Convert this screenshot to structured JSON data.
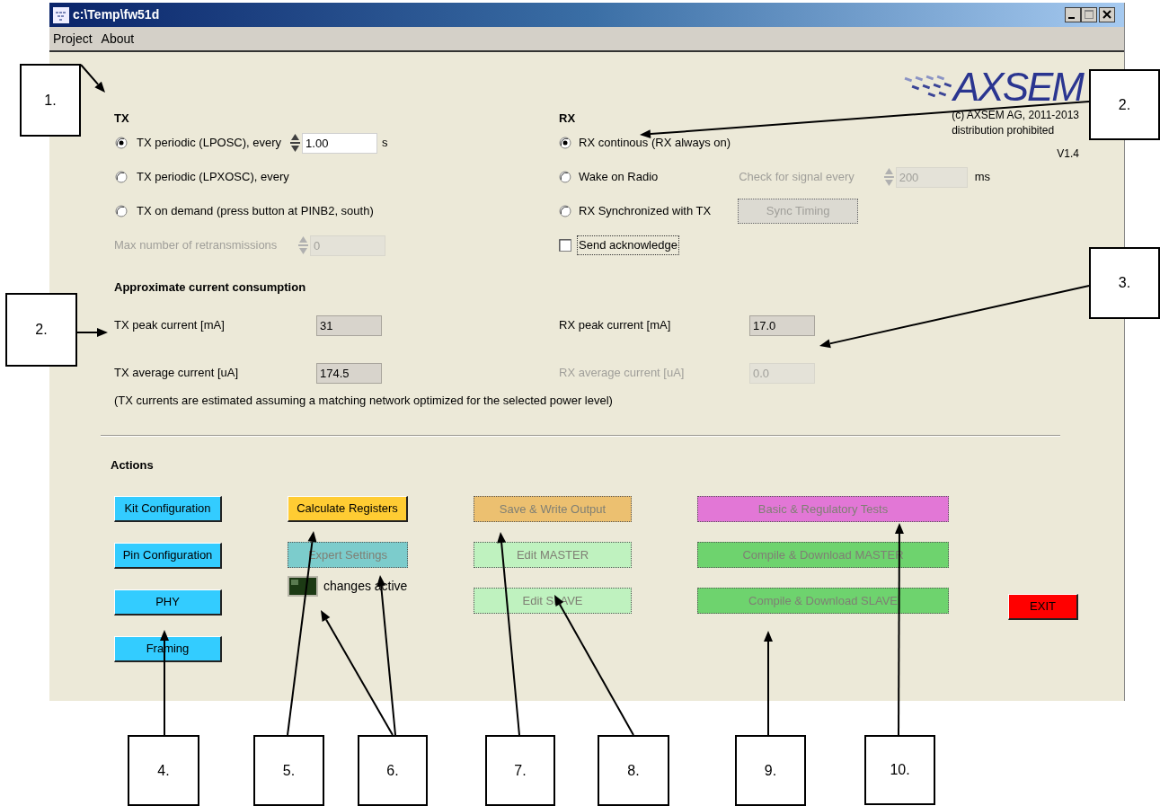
{
  "window": {
    "title": "c:\\Temp\\fw51d"
  },
  "menu": [
    "Project",
    "About"
  ],
  "brand": {
    "wordmark": "AXSEM",
    "copyright": "(c) AXSEM AG, 2011-2013",
    "notice": "distribution prohibited",
    "version": "V1.4"
  },
  "tx": {
    "heading": "TX",
    "options": [
      {
        "label": "TX periodic (LPOSC), every",
        "selected": true
      },
      {
        "label": "TX periodic (LPXOSC), every",
        "selected": false
      },
      {
        "label": "TX on demand (press button at PINB2, south)",
        "selected": false
      }
    ],
    "interval": {
      "value": "1.00",
      "unit": "s"
    },
    "retransmissions": {
      "label": "Max number of retransmissions",
      "value": "0",
      "disabled": true
    }
  },
  "rx": {
    "heading": "RX",
    "options": [
      {
        "label": "RX continous (RX always on)",
        "selected": true
      },
      {
        "label": "Wake on Radio",
        "selected": false
      },
      {
        "label": "RX Synchronized with TX",
        "selected": false
      }
    ],
    "check_interval": {
      "label": "Check for signal every",
      "value": "200",
      "unit": "ms",
      "disabled": true
    },
    "sync_button": {
      "label": "Sync Timing",
      "disabled": true
    },
    "acknowledge": {
      "label": "Send acknowledge",
      "checked": false
    }
  },
  "current": {
    "heading": "Approximate current consumption",
    "fields": [
      {
        "label": "TX peak current [mA]",
        "value": "31",
        "disabled": false
      },
      {
        "label": "RX peak current [mA]",
        "value": "17.0",
        "disabled": false
      },
      {
        "label": "TX average current [uA]",
        "value": "174.5",
        "disabled": false
      },
      {
        "label": "RX average current [uA]",
        "value": "0.0",
        "disabled": true
      }
    ],
    "note": "(TX currents are estimated assuming a matching network optimized for the selected power level)"
  },
  "actions": {
    "heading": "Actions",
    "columns": [
      {
        "items": [
          {
            "kind": "button",
            "label": "Kit Configuration",
            "color": "#33ccff",
            "disabled": false
          },
          {
            "kind": "button",
            "label": "Pin Configuration",
            "color": "#33ccff",
            "disabled": false
          },
          {
            "kind": "button",
            "label": "PHY",
            "color": "#33ccff",
            "disabled": false
          },
          {
            "kind": "button",
            "label": "Framing",
            "color": "#33ccff",
            "disabled": false
          }
        ]
      },
      {
        "items": [
          {
            "kind": "button",
            "label": "Calculate Registers",
            "color": "#ffcc33",
            "disabled": false
          },
          {
            "kind": "button",
            "label": "Expert Settings",
            "color": "#7ccccc",
            "disabled": true
          },
          {
            "kind": "indicator",
            "label": "changes active",
            "on": false
          }
        ]
      },
      {
        "items": [
          {
            "kind": "button",
            "label": "Save & Write Output",
            "color": "#ecc070",
            "disabled": true
          },
          {
            "kind": "button",
            "label": "Edit MASTER",
            "color": "#bff2bf",
            "disabled": true
          },
          {
            "kind": "button",
            "label": "Edit SLAVE",
            "color": "#bff2bf",
            "disabled": true
          }
        ]
      },
      {
        "items": [
          {
            "kind": "button",
            "label": "Basic & Regulatory Tests",
            "color": "#e277d6",
            "disabled": true
          },
          {
            "kind": "button",
            "label": "Compile & Download MASTER",
            "color": "#6ed36e",
            "disabled": true
          },
          {
            "kind": "button",
            "label": "Compile & Download SLAVE",
            "color": "#6ed36e",
            "disabled": true
          }
        ]
      }
    ],
    "exit_button": {
      "label": "EXIT",
      "color": "#ff0000",
      "disabled": false
    }
  },
  "callouts": [
    {
      "label": "1."
    },
    {
      "label": "2."
    },
    {
      "label": "3."
    },
    {
      "label": "2."
    },
    {
      "label": "4."
    },
    {
      "label": "5."
    },
    {
      "label": "6."
    },
    {
      "label": "7."
    },
    {
      "label": "8."
    },
    {
      "label": "9."
    },
    {
      "label": "10."
    }
  ]
}
